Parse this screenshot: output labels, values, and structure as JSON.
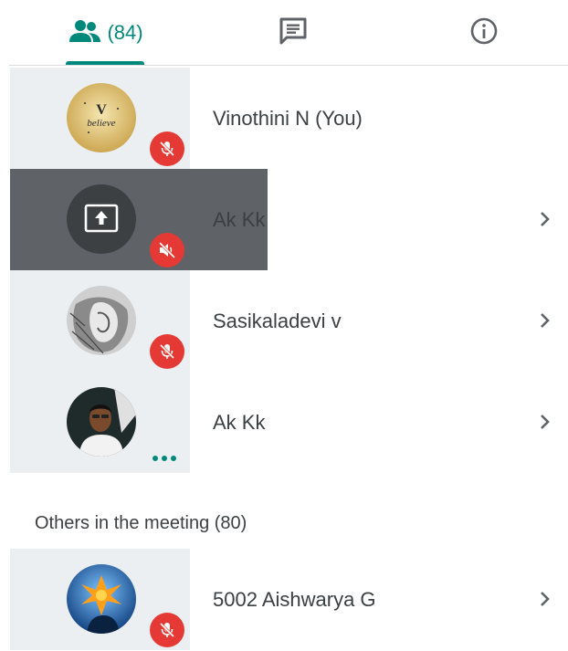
{
  "tabs": {
    "people_count": "(84)",
    "active": "people",
    "accent": "#00897b"
  },
  "participants": [
    {
      "name": "Vinothini N (You)",
      "avatar_text": "believe",
      "status": "muted",
      "has_chevron": false
    },
    {
      "name": "Ak Kk",
      "status": "presenting",
      "audio": "volume-muted",
      "has_chevron": true
    },
    {
      "name": "Sasikaladevi v",
      "status": "muted",
      "has_chevron": true
    },
    {
      "name": "Ak Kk",
      "status": "speaking",
      "has_chevron": true
    }
  ],
  "others": {
    "label": "Others in the meeting (80)",
    "items": [
      {
        "name": "5002 Aishwarya G",
        "status": "muted",
        "has_chevron": true
      }
    ]
  },
  "colors": {
    "muted_badge": "#e53935",
    "presenting_bg": "#5f6368",
    "tile_bg": "#eceff1"
  }
}
